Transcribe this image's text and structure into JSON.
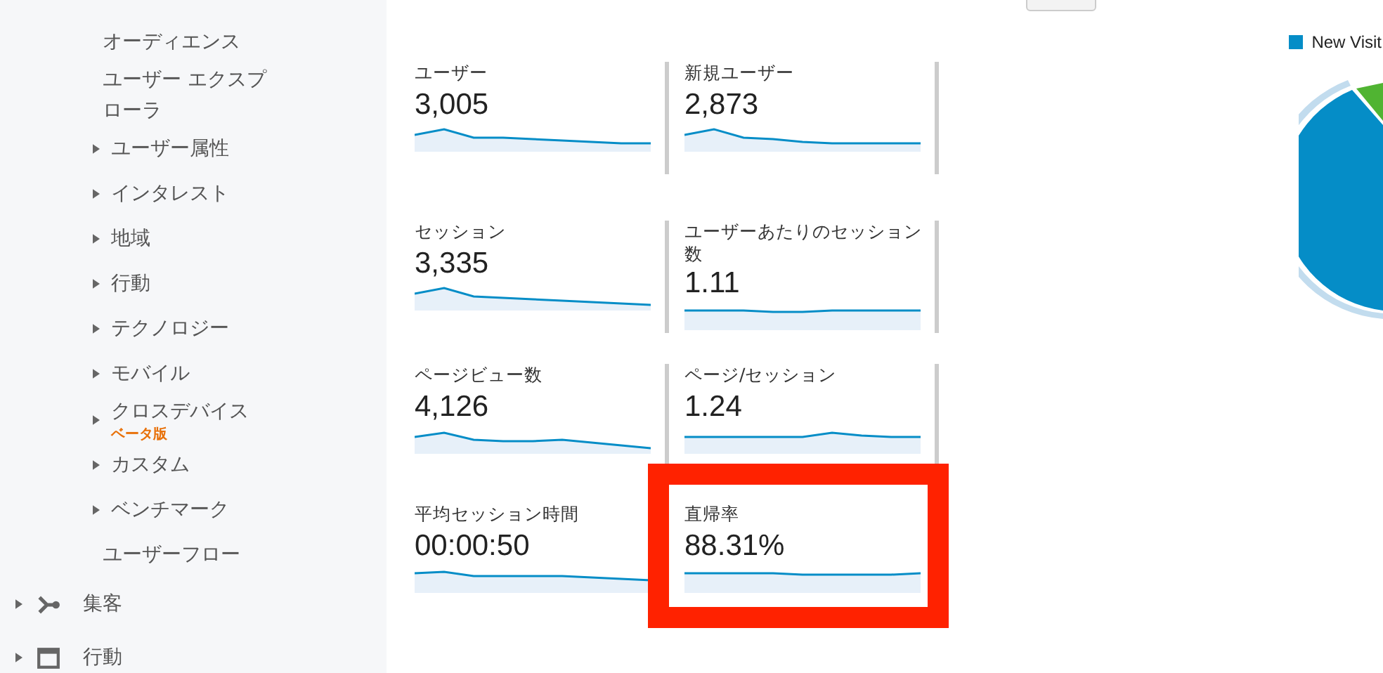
{
  "sidebar": {
    "items": [
      {
        "label": "オーディエンス",
        "expandable": false
      },
      {
        "label": "ユーザー エクスプローラ",
        "expandable": false
      },
      {
        "label": "ユーザー属性",
        "expandable": true
      },
      {
        "label": "インタレスト",
        "expandable": true
      },
      {
        "label": "地域",
        "expandable": true
      },
      {
        "label": "行動",
        "expandable": true
      },
      {
        "label": "テクノロジー",
        "expandable": true
      },
      {
        "label": "モバイル",
        "expandable": true
      },
      {
        "label": "クロスデバイス",
        "expandable": true,
        "badge": "ベータ版"
      },
      {
        "label": "カスタム",
        "expandable": true
      },
      {
        "label": "ベンチマーク",
        "expandable": true
      },
      {
        "label": "ユーザーフロー",
        "expandable": false
      }
    ],
    "sections": [
      {
        "label": "集客",
        "kind": "flow"
      },
      {
        "label": "行動",
        "kind": "window"
      }
    ]
  },
  "metrics": [
    {
      "label": "ユーザー",
      "value": "3,005",
      "highlighted": false
    },
    {
      "label": "新規ユーザー",
      "value": "2,873",
      "highlighted": false
    },
    {
      "label": "セッション",
      "value": "3,335",
      "highlighted": false
    },
    {
      "label": "ユーザーあたりのセッション数",
      "value": "1.11",
      "highlighted": false
    },
    {
      "label": "ページビュー数",
      "value": "4,126",
      "highlighted": false
    },
    {
      "label": "ページ/セッション",
      "value": "1.24",
      "highlighted": false
    },
    {
      "label": "平均セッション時間",
      "value": "00:00:50",
      "highlighted": false
    },
    {
      "label": "直帰率",
      "value": "88.31%",
      "highlighted": true
    }
  ],
  "legend": {
    "label": "New Visit",
    "color": "#058dc7"
  }
}
